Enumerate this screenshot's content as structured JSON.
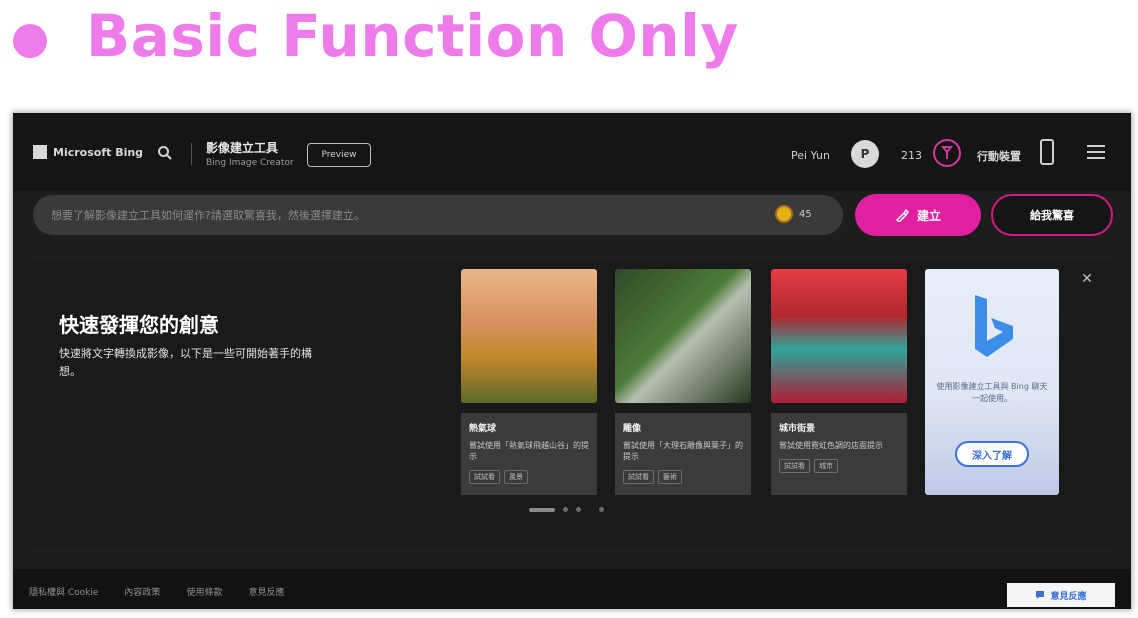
{
  "headline": {
    "text": "Basic Function Only",
    "color": "#ee7bea"
  },
  "screen": {
    "topbar": {
      "logo_text": "Microsoft Bing",
      "product_title": "影像建立工具",
      "product_subtitle": "Bing Image Creator",
      "preview_badge": "Preview",
      "user_name": "Pei Yun",
      "avatar_initial": "P",
      "points": "213",
      "app_label": "行動裝置",
      "icons": [
        "search-icon",
        "reward-icon",
        "phone-icon",
        "menu-icon"
      ]
    },
    "prompt": {
      "placeholder": "想要了解影像建立工具如何運作?請選取驚喜我，然後選擇建立。",
      "boost_count": "45",
      "create_label": "建立",
      "surprise_label": "給我驚喜"
    },
    "panel": {
      "title": "快速發揮您的創意",
      "description": "快速將文字轉換成影像，以下是一些可開始著手的構想。",
      "cards": [
        {
          "title": "熱氣球",
          "description": "嘗試使用「熱氣球飛越山谷」的提示",
          "tags": [
            "試試看",
            "風景"
          ]
        },
        {
          "title": "雕像",
          "description": "嘗試使用「大理石雕像與葉子」的提示",
          "tags": [
            "試試看",
            "藝術"
          ]
        },
        {
          "title": "城市街景",
          "description": "嘗試使用霓虹色調的店面提示",
          "tags": [
            "試試看",
            "城市"
          ]
        }
      ],
      "promo": {
        "text": "使用影像建立工具與 Bing 聊天一起使用。",
        "button": "深入了解"
      },
      "close_icon": "✕"
    },
    "footer": {
      "links": [
        "隱私權與 Cookie",
        "內容政策",
        "使用條款",
        "意見反應"
      ],
      "feedback_label": "意見反應"
    }
  }
}
